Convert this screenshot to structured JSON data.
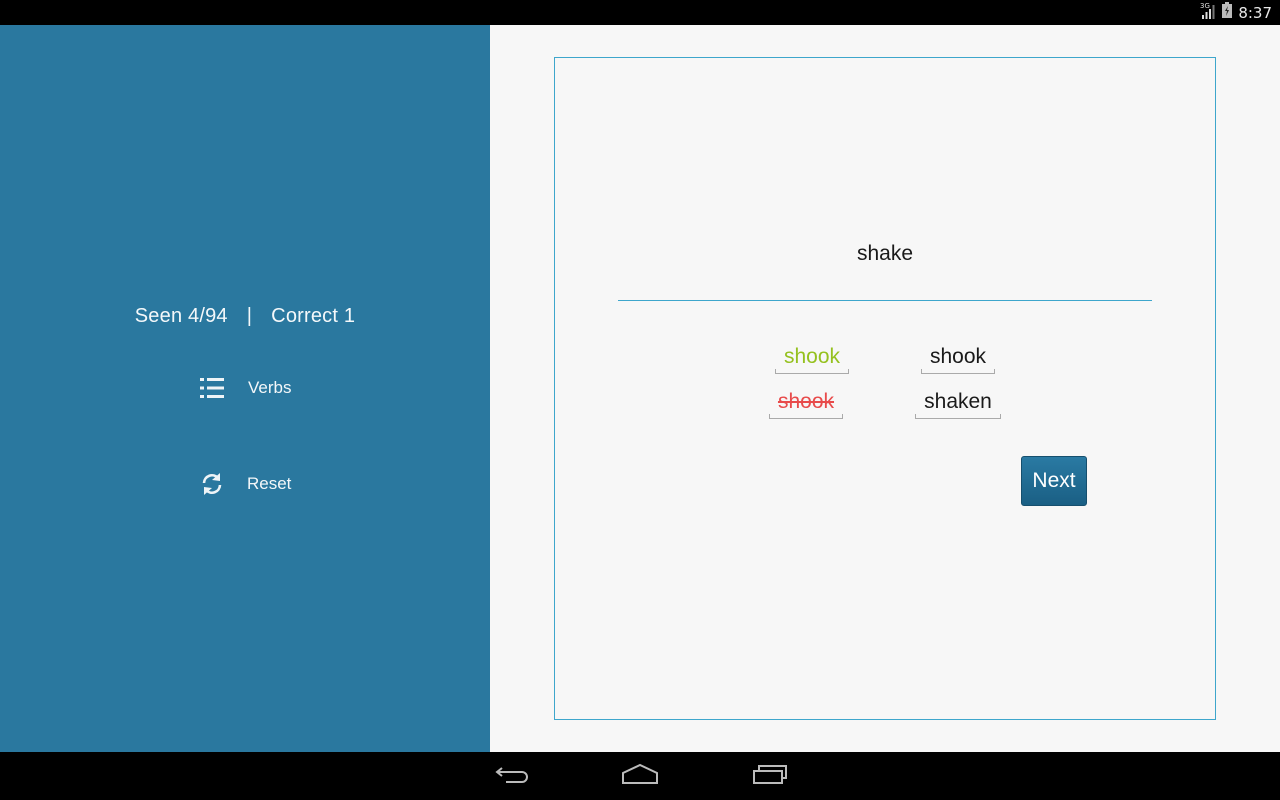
{
  "status_bar": {
    "network": "3G",
    "time": "8:37",
    "icons": [
      "signal-3g-icon",
      "battery-charging-icon"
    ]
  },
  "sidebar": {
    "seen_label": "Seen 4/94",
    "separator": "|",
    "correct_label": "Correct 1",
    "items": [
      {
        "label": "Verbs",
        "icon": "list-icon"
      },
      {
        "label": "Reset",
        "icon": "refresh-icon"
      }
    ]
  },
  "quiz": {
    "verb": "shake",
    "answers": [
      {
        "text": "shook",
        "state": "correct",
        "color": "#95c11f"
      },
      {
        "text": "shook",
        "state": "neutral",
        "color": "#1a1a1a"
      },
      {
        "text": "shook",
        "state": "wrong",
        "color": "#e84b4b"
      },
      {
        "text": "shaken",
        "state": "neutral",
        "color": "#1a1a1a"
      }
    ],
    "next_label": "Next"
  },
  "colors": {
    "sidebar_bg": "#2a789f",
    "accent": "#3ea6cc",
    "correct": "#95c11f",
    "wrong": "#e84b4b",
    "button": "#1f6a92"
  },
  "nav_bar": {
    "buttons": [
      "back-icon",
      "home-icon",
      "recent-apps-icon"
    ]
  }
}
